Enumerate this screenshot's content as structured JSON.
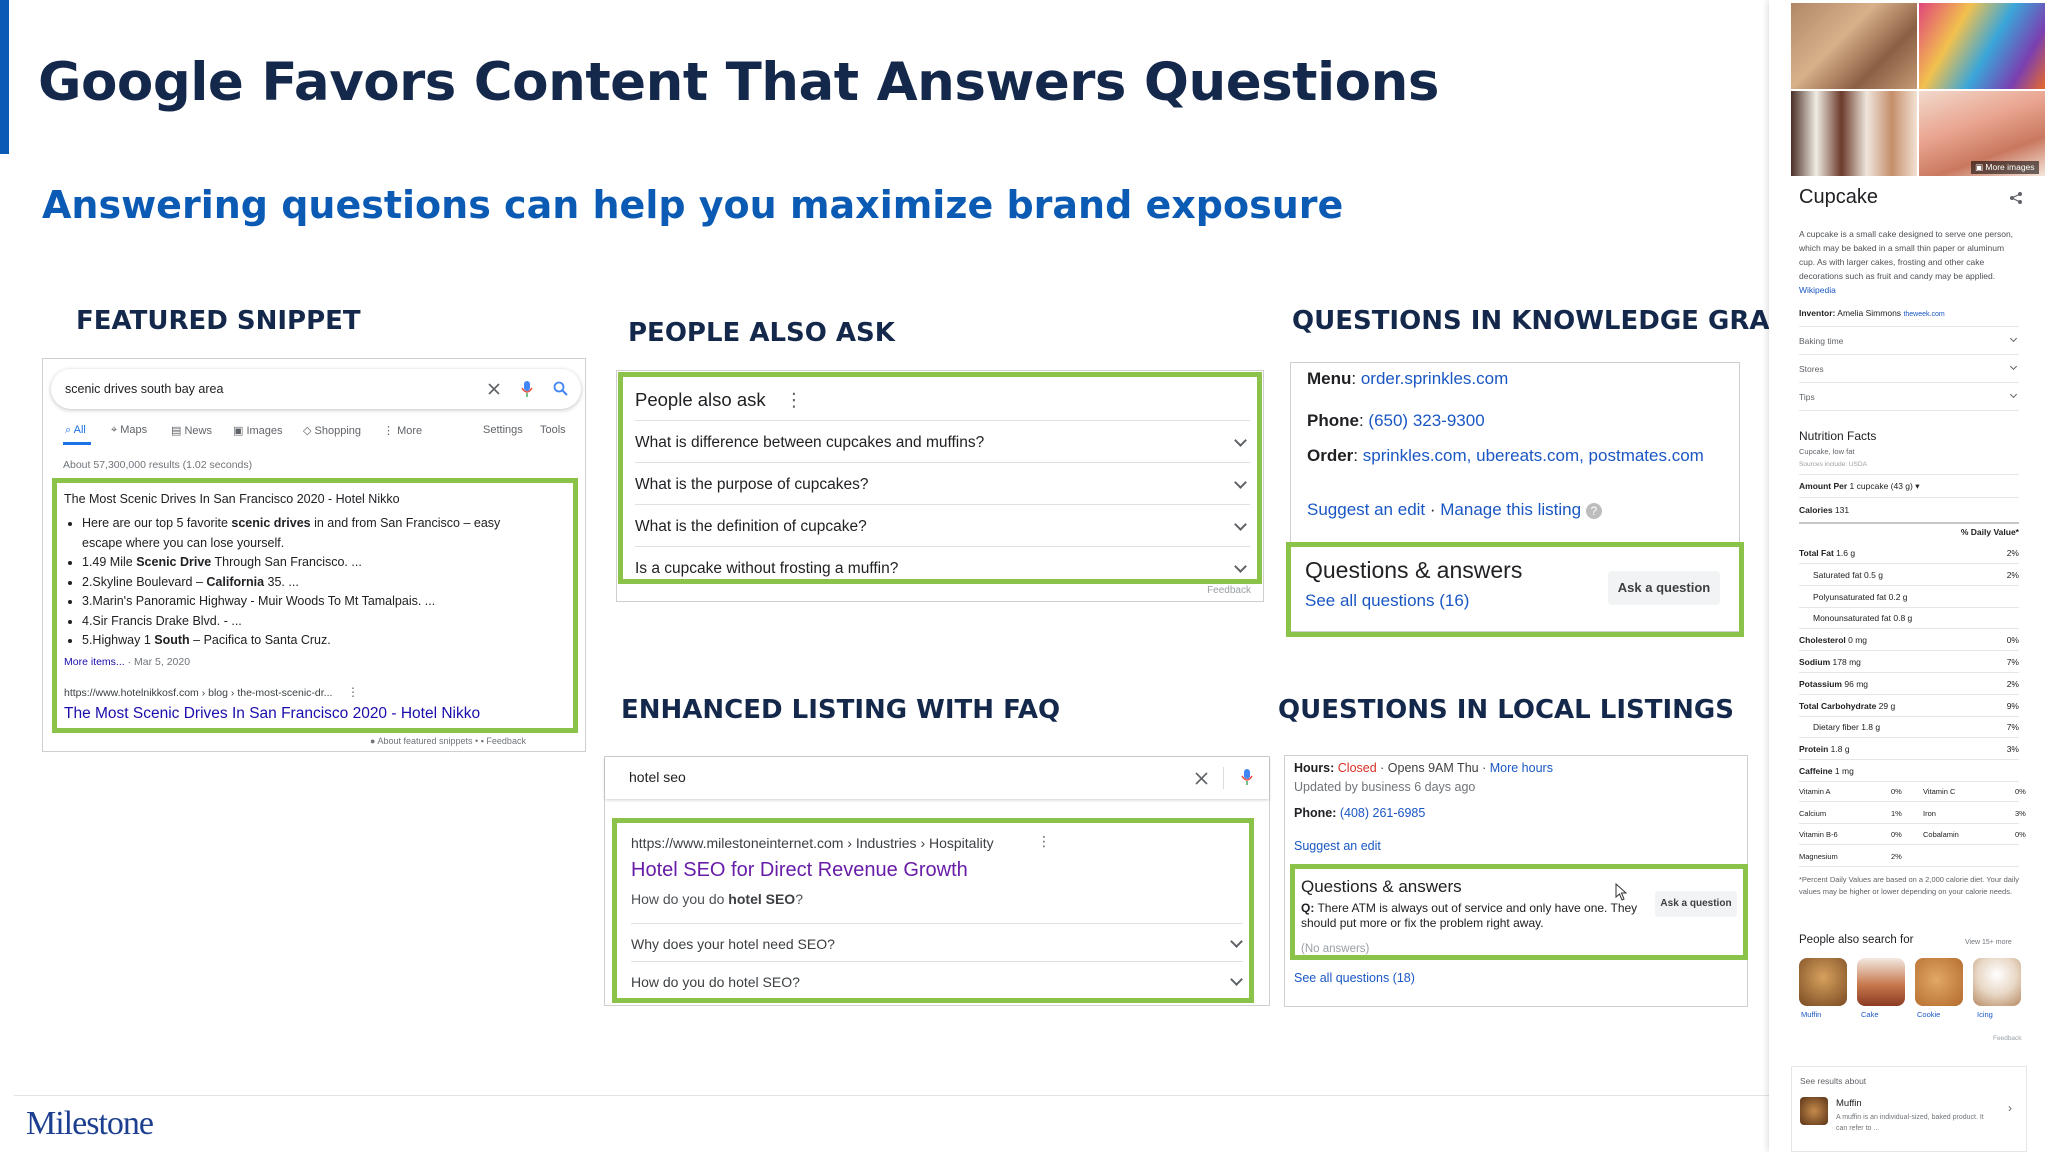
{
  "slide": {
    "title": "Google Favors Content That Answers Questions",
    "subtitle": "Answering questions can help you maximize brand exposure",
    "logo": "Milestone"
  },
  "sections": {
    "featured_snippet": "FEATURED SNIPPET",
    "people_also_ask": "PEOPLE ALSO ASK",
    "knowledge_graph": "QUESTIONS IN KNOWLEDGE GRAPH",
    "enhanced_listing": "ENHANCED LISTING WITH FAQ",
    "local_listings": "QUESTIONS IN LOCAL LISTINGS"
  },
  "featured_snippet": {
    "query": "scenic drives south bay area",
    "tabs": [
      "All",
      "Maps",
      "News",
      "Images",
      "Shopping",
      "More",
      "Settings",
      "Tools"
    ],
    "results_count": "About 57,300,000 results (1.02 seconds)",
    "snippet_title": "The Most Scenic Drives In San Francisco 2020 - Hotel Nikko",
    "bullet_1_pre": "Here are our top 5 favorite ",
    "bullet_1_bold": "scenic drives",
    "bullet_1_post": " in and from San Francisco – easy escape where you can lose yourself.",
    "bullet_2_pre": "1.49 Mile ",
    "bullet_2_bold": "Scenic Drive",
    "bullet_2_post": " Through San Francisco. ...",
    "bullet_3_pre": "2.Skyline Boulevard – ",
    "bullet_3_bold": "California",
    "bullet_3_post": " 35. ...",
    "bullet_4": "3.Marin's Panoramic Highway - Muir Woods To Mt Tamalpais. ...",
    "bullet_5": "4.Sir Francis Drake Blvd. - ...",
    "bullet_6_pre": "5.Highway 1 ",
    "bullet_6_bold": "South",
    "bullet_6_post": " – Pacifica to Santa Cruz.",
    "more_items": "More items...",
    "date": "Mar 5, 2020",
    "url": "https://www.hotelnikkosf.com › blog › the-most-scenic-dr...",
    "link_title": "The Most Scenic Drives In San Francisco 2020 - Hotel Nikko",
    "about": "About featured snippets",
    "feedback": "Feedback"
  },
  "people_also_ask": {
    "heading": "People also ask",
    "questions": [
      "What is difference between cupcakes and muffins?",
      "What is the purpose of cupcakes?",
      "What is the definition of cupcake?",
      "Is a cupcake without frosting a muffin?"
    ],
    "feedback": "Feedback"
  },
  "knowledge_graph": {
    "menu_label": "Menu",
    "menu_value": "order.sprinkles.com",
    "phone_label": "Phone",
    "phone_value": "(650) 323-9300",
    "order_label": "Order",
    "order_value": "sprinkles.com, ubereats.com, postmates.com",
    "suggest": "Suggest an edit",
    "manage": "Manage this listing",
    "qa_title": "Questions & answers",
    "qa_link": "See all questions (16)",
    "ask_button": "Ask a question"
  },
  "enhanced_listing": {
    "query": "hotel seo",
    "url": "https://www.milestoneinternet.com › Industries › Hospitality",
    "title": "Hotel SEO for Direct Revenue Growth",
    "desc_pre": "How do you do ",
    "desc_bold": "hotel SEO",
    "desc_post": "?",
    "faqs": [
      "Why does your hotel need SEO?",
      "How do you do hotel SEO?"
    ]
  },
  "local_listings": {
    "hours_label": "Hours:",
    "closed": "Closed",
    "opens": "· Opens 9AM Thu ·",
    "more_hours": "More hours",
    "updated": "Updated by business 6 days ago",
    "phone_label": "Phone:",
    "phone_value": "(408) 261-6985",
    "suggest": "Suggest an edit",
    "qa_title": "Questions & answers",
    "q_label": "Q:",
    "question": "There ATM is always out of service and only have one. They should put more or fix the problem right away.",
    "no_answers": "(No answers)",
    "ask_button": "Ask a question",
    "see_all": "See all questions (18)"
  },
  "knowledge_panel": {
    "more_images": "More images",
    "title": "Cupcake",
    "description": "A cupcake is a small cake designed to serve one person, which may be baked in a small thin paper or aluminum cup. As with larger cakes, frosting and other cake decorations such as fruit and candy may be applied.",
    "wikipedia": "Wikipedia",
    "inventor_label": "Inventor:",
    "inventor_value": "Amelia Simmons",
    "inventor_source": "theweek.com",
    "expanders": [
      "Baking time",
      "Stores",
      "Tips"
    ],
    "nutrition_title": "Nutrition Facts",
    "nutrition_sub": "Cupcake, low fat",
    "sources": "Sources include: USDA",
    "amount_label": "Amount Per",
    "amount_value": "1 cupcake (43 g)",
    "calories_label": "Calories",
    "calories_value": "131",
    "daily_value": "% Daily Value*",
    "nutrients": [
      {
        "name": "Total Fat",
        "amount": "1.6 g",
        "pct": "2%"
      },
      {
        "name": "Saturated fat",
        "amount": "0.5 g",
        "pct": "2%"
      },
      {
        "name": "Polyunsaturated fat",
        "amount": "0.2 g",
        "pct": ""
      },
      {
        "name": "Monounsaturated fat",
        "amount": "0.8 g",
        "pct": ""
      },
      {
        "name": "Cholesterol",
        "amount": "0 mg",
        "pct": "0%"
      },
      {
        "name": "Sodium",
        "amount": "178 mg",
        "pct": "7%"
      },
      {
        "name": "Potassium",
        "amount": "96 mg",
        "pct": "2%"
      },
      {
        "name": "Total Carbohydrate",
        "amount": "29 g",
        "pct": "9%"
      },
      {
        "name": "Dietary fiber",
        "amount": "1.8 g",
        "pct": "7%"
      },
      {
        "name": "Protein",
        "amount": "1.8 g",
        "pct": "3%"
      },
      {
        "name": "Caffeine",
        "amount": "1 mg",
        "pct": ""
      }
    ],
    "vitamins": [
      {
        "a": "Vitamin A",
        "ap": "0%",
        "b": "Vitamin C",
        "bp": "0%"
      },
      {
        "a": "Calcium",
        "ap": "1%",
        "b": "Iron",
        "bp": "3%"
      },
      {
        "a": "Vitamin B-6",
        "ap": "0%",
        "b": "Cobalamin",
        "bp": "0%"
      },
      {
        "a": "Magnesium",
        "ap": "2%",
        "b": "",
        "bp": ""
      }
    ],
    "footnote": "*Percent Daily Values are based on a 2,000 calorie diet. Your daily values may be higher or lower depending on your calorie needs.",
    "also_search_title": "People also search for",
    "view_more": "View 15+ more",
    "also_search": [
      "Muffin",
      "Cake",
      "Cookie",
      "Icing"
    ],
    "feedback": "Feedback",
    "see_results": "See results about",
    "result_title": "Muffin",
    "result_desc": "A muffin is an individual-sized, baked product. It can refer to ..."
  }
}
